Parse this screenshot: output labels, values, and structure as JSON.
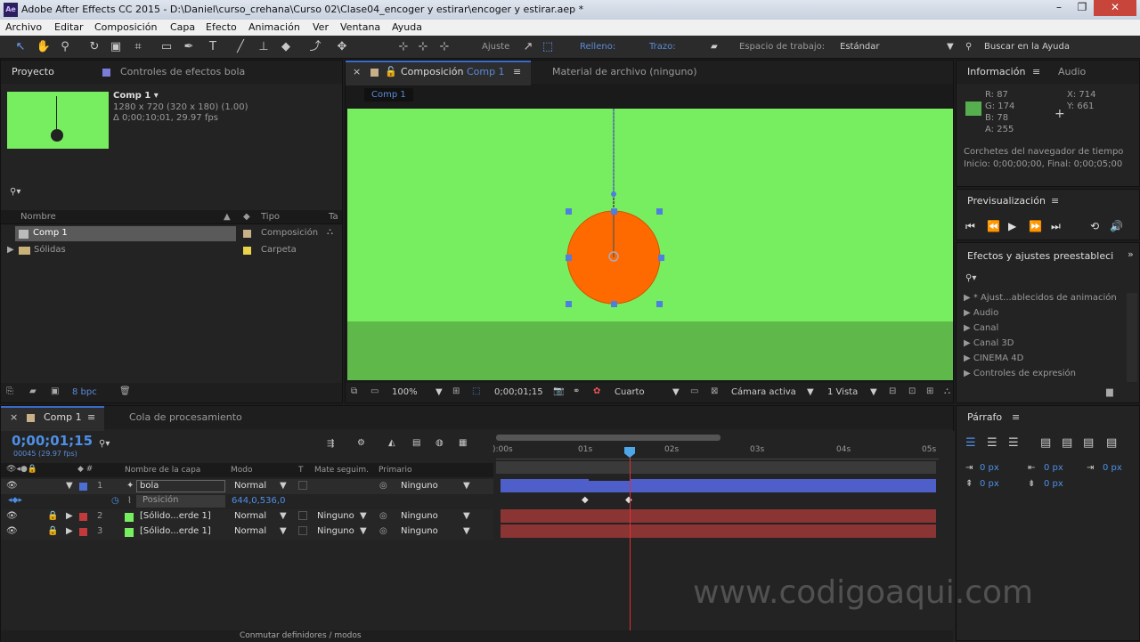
{
  "window": {
    "title": "Adobe After Effects CC 2015 - D:\\Daniel\\curso_crehana\\Curso 02\\Clase04_encoger y estirar\\encoger y estirar.aep *",
    "app_icon": "Ae"
  },
  "menu": [
    "Archivo",
    "Editar",
    "Composición",
    "Capa",
    "Efecto",
    "Animación",
    "Ver",
    "Ventana",
    "Ayuda"
  ],
  "toolbar": {
    "ajuste": "Ajuste",
    "relleno": "Relleno:",
    "trazo": "Trazo:",
    "espacio": "Espacio de trabajo:",
    "workspace": "Estándar",
    "buscar": "Buscar en la Ayuda",
    "fill_color": "#ff6a00"
  },
  "project": {
    "tab": "Proyecto",
    "tab2": "Controles de efectos bola",
    "comp_name": "Comp 1 ▾",
    "comp_info1": "1280 x 720  (320 x 180) (1.00)",
    "comp_info2": "Δ 0;00;10;01, 29.97 fps",
    "col_name": "Nombre",
    "col_type": "Tipo",
    "col_ta": "Ta",
    "items": [
      {
        "name": "Comp 1",
        "type": "Composición",
        "color": "#c8b089"
      },
      {
        "name": "Sólidas",
        "type": "Carpeta",
        "color": "#e8d44a"
      }
    ],
    "bpc": "8 bpc"
  },
  "composition": {
    "tab": "Composición Comp 1",
    "tab_prefix": "Composición",
    "tab_comp": "Comp 1",
    "footage_tab": "Material de archivo (ninguno)",
    "breadcrumb": "Comp 1",
    "zoom": "100%",
    "time": "0;00;01;15",
    "resolution": "Cuarto",
    "camera": "Cámara activa",
    "views": "1 Vista",
    "bg_color": "#77ee5f",
    "ground_color": "#5fb84a",
    "ball_color": "#ff6a00"
  },
  "info": {
    "tab": "Información",
    "tab2": "Audio",
    "r": "R: 87",
    "g": "G: 174",
    "b": "B: 78",
    "a": "A: 255",
    "x": "X: 714",
    "y": "Y: 661",
    "swatch": "#57ae4e",
    "note1": "Corchetes del navegador de tiempo",
    "note2": "Inicio: 0;00;00;00, Final: 0;00;05;00"
  },
  "preview": {
    "tab": "Previsualización"
  },
  "effects": {
    "tab": "Efectos y ajustes preestableci",
    "items": [
      "* Ajust...ablecidos de animación",
      "Audio",
      "Canal",
      "Canal 3D",
      "CINEMA 4D",
      "Controles de expresión"
    ]
  },
  "paragraph": {
    "tab": "Párrafo",
    "px": "0 px"
  },
  "timeline": {
    "tab": "Comp 1",
    "tab2": "Cola de procesamiento",
    "time": "0;00;01;15",
    "frames": "00045 (29.97 fps)",
    "col_name": "Nombre de la capa",
    "col_mode": "Modo",
    "col_t": "T",
    "col_mate": "Mate seguim.",
    "col_parent": "Primario",
    "rulers": [
      "):00s",
      "01s",
      "02s",
      "03s",
      "04s",
      "05s"
    ],
    "layers": [
      {
        "num": "1",
        "name": "bola",
        "mode": "Normal",
        "mate": "",
        "parent": "Ninguno",
        "color": "#4c6fd6",
        "bar": "#4f5fc9"
      },
      {
        "num": "2",
        "name": "[Sólido...erde 1]",
        "mode": "Normal",
        "mate": "Ninguno",
        "parent": "Ninguno",
        "color": "#c23a3a",
        "bar": "#8a3434"
      },
      {
        "num": "3",
        "name": "[Sólido...erde 1]",
        "mode": "Normal",
        "mate": "Ninguno",
        "parent": "Ninguno",
        "color": "#c23a3a",
        "bar": "#8a3434"
      }
    ],
    "position_label": "Posición",
    "position_value": "644,0,536,0",
    "footer": "Conmutar definidores / modos"
  },
  "watermark": "www.codigoaqui.com"
}
